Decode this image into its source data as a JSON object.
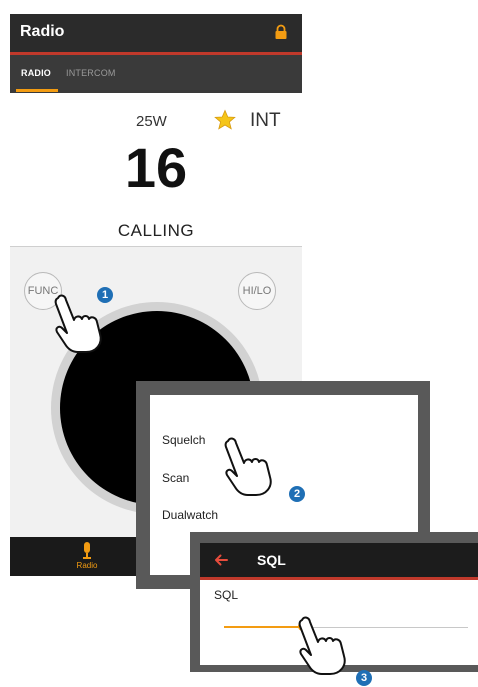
{
  "colors": {
    "accent": "#f39c12",
    "callout": "#1f6fb5",
    "divider_red": "#c0392b"
  },
  "app": {
    "title": "Radio",
    "lock_icon": "lock-icon"
  },
  "tabs": [
    {
      "label": "RADIO",
      "active": true
    },
    {
      "label": "INTERCOM",
      "active": false
    }
  ],
  "status": {
    "power": "25W",
    "favorite_icon": "star-icon",
    "band": "INT"
  },
  "channel": {
    "number": "16",
    "name": "CALLING"
  },
  "buttons": {
    "func": "FUNC",
    "hilo": "HI/LO"
  },
  "bottom_nav": {
    "radio_label": "Radio"
  },
  "function_menu": {
    "items": [
      "Squelch",
      "Scan",
      "Dualwatch"
    ]
  },
  "sql_screen": {
    "title": "SQL",
    "label": "SQL",
    "slider_level": 0.32
  },
  "callouts": [
    "1",
    "2",
    "3"
  ]
}
